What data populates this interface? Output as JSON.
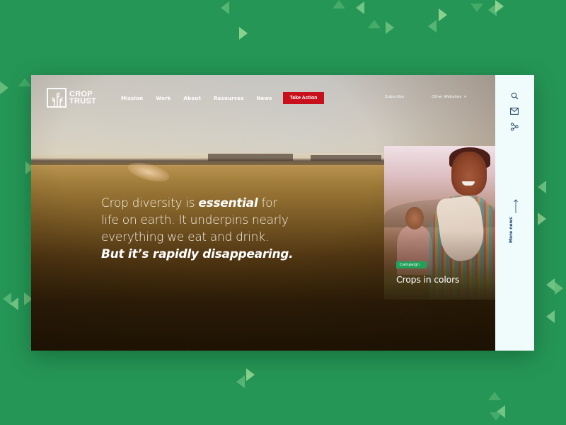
{
  "brand": {
    "name_line1": "CROP",
    "name_line2": "TRUST"
  },
  "nav": {
    "items": [
      {
        "label": "Mission"
      },
      {
        "label": "Work"
      },
      {
        "label": "About"
      },
      {
        "label": "Resources"
      },
      {
        "label": "News"
      }
    ],
    "cta_label": "Take Action",
    "subscribe_label": "Subscribe",
    "other_websites_label": "Other Websites",
    "other_websites_caret": "▾"
  },
  "hero": {
    "line1_pre": "Crop diversity is ",
    "line1_em": "essential",
    "line1_post": " for",
    "line2": "life on earth. It underpins nearly",
    "line3": "everything we eat and drink.",
    "line4_em": "But it’s rapidly disappearing."
  },
  "news_card": {
    "badge": "Campaign",
    "title": "Crops in colors"
  },
  "sidebar": {
    "icons": [
      "search-icon",
      "mail-icon",
      "share-icon"
    ],
    "more_news_label": "More news",
    "arrow_glyph": "↑"
  },
  "colors": {
    "background_green": "#259656",
    "cta_red": "#c8101d",
    "badge_green": "#22a05a",
    "sidebar_bg": "#f0fbfc",
    "sidebar_text": "#17456e"
  }
}
